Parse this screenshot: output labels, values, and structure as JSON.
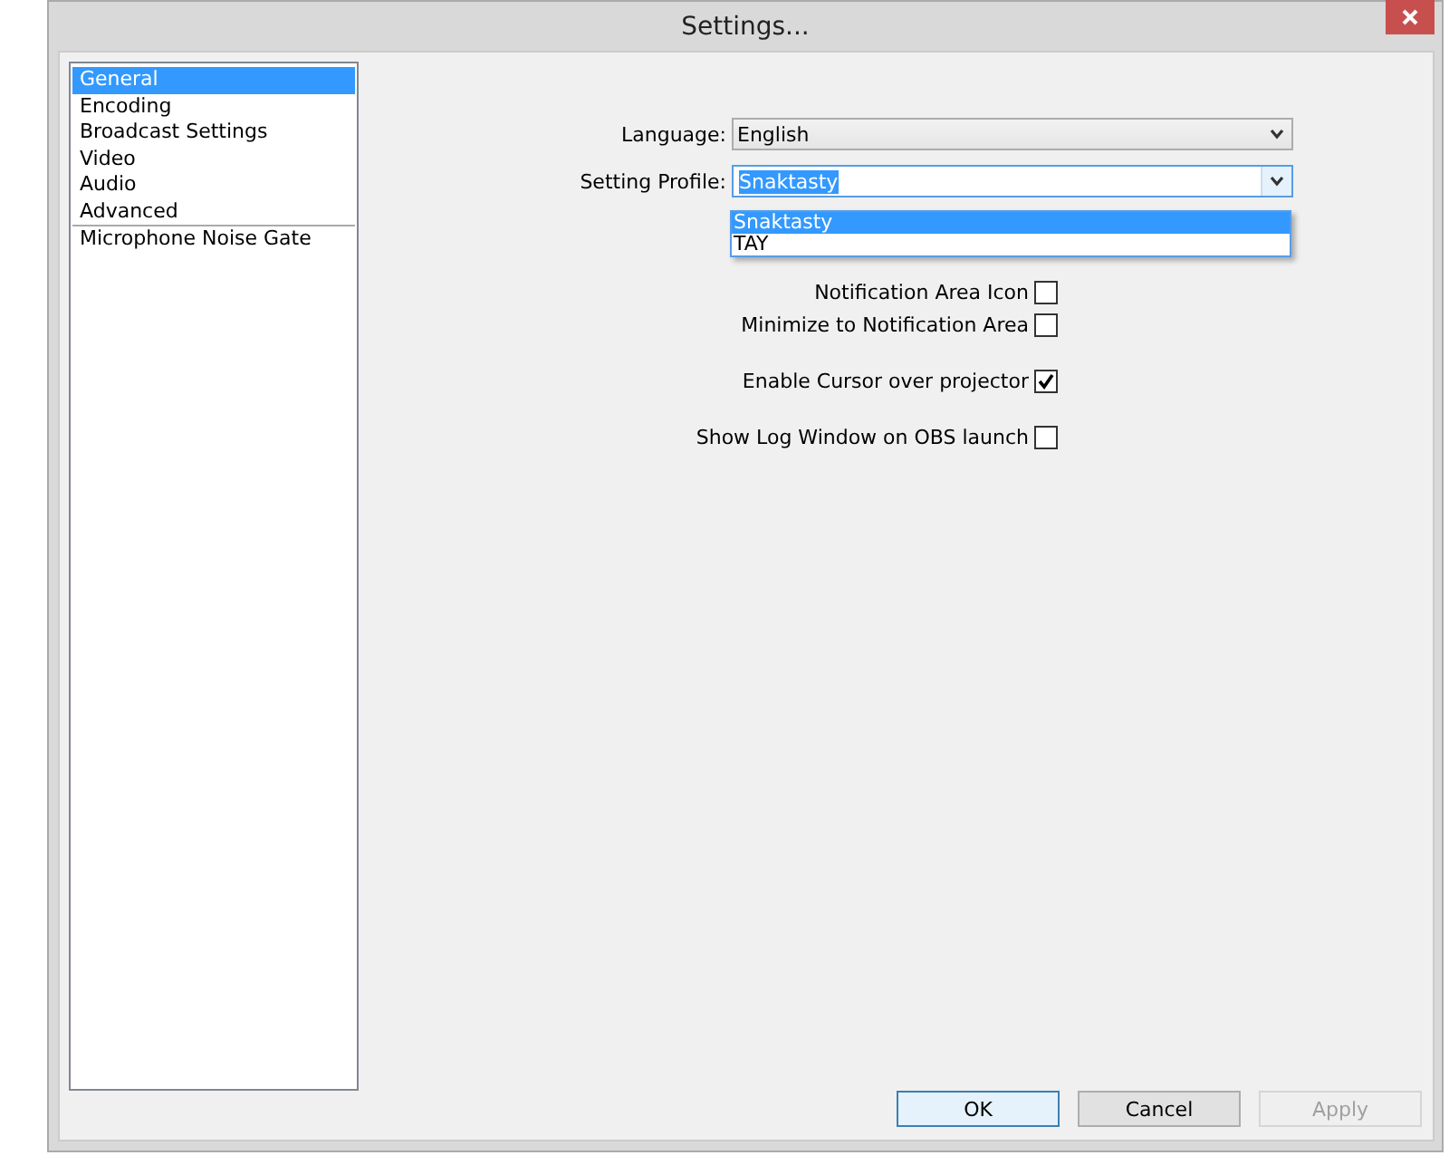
{
  "window": {
    "title": "Settings..."
  },
  "sidebar": {
    "groups": [
      [
        {
          "label": "General",
          "selected": true
        },
        {
          "label": "Encoding",
          "selected": false
        },
        {
          "label": "Broadcast Settings",
          "selected": false
        },
        {
          "label": "Video",
          "selected": false
        },
        {
          "label": "Audio",
          "selected": false
        },
        {
          "label": "Advanced",
          "selected": false
        }
      ],
      [
        {
          "label": "Microphone Noise Gate",
          "selected": false
        }
      ]
    ]
  },
  "general": {
    "language": {
      "label": "Language:",
      "value": "English"
    },
    "profile": {
      "label": "Setting Profile:",
      "value": "Snaktasty",
      "expanded": true,
      "options": [
        {
          "label": "Snaktasty",
          "selected": true
        },
        {
          "label": "TAY",
          "selected": false
        }
      ]
    },
    "checkbox_groups": [
      [
        {
          "label": "Notification Area Icon",
          "checked": false
        },
        {
          "label": "Minimize to Notification Area",
          "checked": false
        }
      ],
      [
        {
          "label": "Enable Cursor over projector",
          "checked": true
        }
      ],
      [
        {
          "label": "Show Log Window on OBS launch",
          "checked": false
        }
      ]
    ]
  },
  "buttons": [
    {
      "label": "OK",
      "default": true,
      "disabled": false
    },
    {
      "label": "Cancel",
      "default": false,
      "disabled": false
    },
    {
      "label": "Apply",
      "default": false,
      "disabled": true
    }
  ]
}
